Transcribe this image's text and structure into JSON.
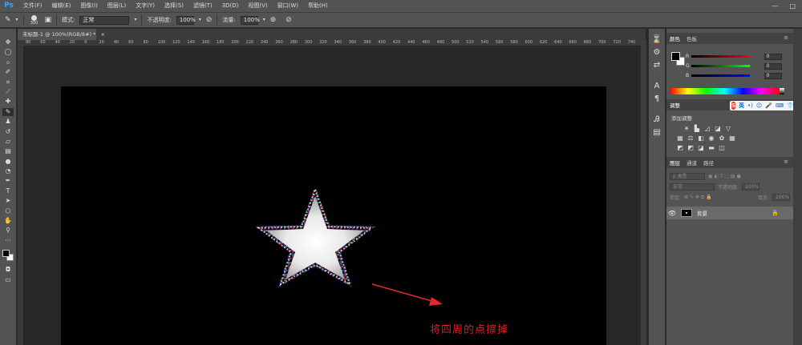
{
  "app": {
    "logo": "Ps"
  },
  "menu": [
    "文件(F)",
    "编辑(E)",
    "图像(I)",
    "图层(L)",
    "文字(Y)",
    "选择(S)",
    "滤镜(T)",
    "3D(D)",
    "视图(V)",
    "窗口(W)",
    "帮助(H)"
  ],
  "options": {
    "brush_size": "300",
    "mode_label": "模式:",
    "mode_value": "正常",
    "opacity_label": "不透明度:",
    "opacity_value": "100%",
    "flow_label": "流量:",
    "flow_value": "100%"
  },
  "document": {
    "tab_title": "未标题-1 @ 100%(RGB/8#) *"
  },
  "ruler_labels": [
    "80",
    "60",
    "40",
    "20",
    "0",
    "20",
    "40",
    "60",
    "80",
    "100",
    "120",
    "140",
    "160",
    "180",
    "200",
    "220",
    "240",
    "260",
    "280",
    "300",
    "320",
    "340",
    "360",
    "380",
    "400",
    "420",
    "440",
    "460",
    "480",
    "500",
    "520",
    "540",
    "560",
    "580",
    "600",
    "620",
    "640",
    "660",
    "680",
    "700",
    "720",
    "740"
  ],
  "annotation": {
    "text": "将四周的点擦掉",
    "color": "#d0232a"
  },
  "color_panel": {
    "tabs": [
      "颜色",
      "色板"
    ],
    "channels": [
      {
        "label": "R",
        "value": "0",
        "color": "#e0262b"
      },
      {
        "label": "G",
        "value": "0",
        "color": "#22b14c"
      },
      {
        "label": "B",
        "value": "0",
        "color": "#2a3bd6"
      }
    ]
  },
  "adjust_panel": {
    "tab": "调整",
    "subtitle": "添加调整",
    "ime": {
      "logo": "S",
      "label": "英"
    }
  },
  "layers_panel": {
    "tabs": [
      "图层",
      "通道",
      "路径"
    ],
    "filter_label": "ρ 类型",
    "blend_mode": "正常",
    "opacity_label": "不透明度:",
    "opacity_value": "100%",
    "lock_label": "锁定:",
    "fill_label": "填充:",
    "fill_value": "100%",
    "layers": [
      {
        "name": "背景"
      }
    ]
  },
  "colors": {
    "ui_bg": "#535353",
    "canvas": "#000000",
    "annotation": "#d0232a",
    "accent_blue": "#31a8ff"
  },
  "icons": {
    "tools": [
      "move-icon",
      "marquee-icon",
      "lasso-icon",
      "quick-select-icon",
      "crop-icon",
      "eyedropper-icon",
      "healing-icon",
      "brush-icon",
      "stamp-icon",
      "history-brush-icon",
      "eraser-icon",
      "gradient-icon",
      "blur-icon",
      "dodge-icon",
      "pen-icon",
      "type-icon",
      "path-select-icon",
      "shape-icon",
      "hand-icon",
      "zoom-icon",
      "more-icon"
    ]
  }
}
